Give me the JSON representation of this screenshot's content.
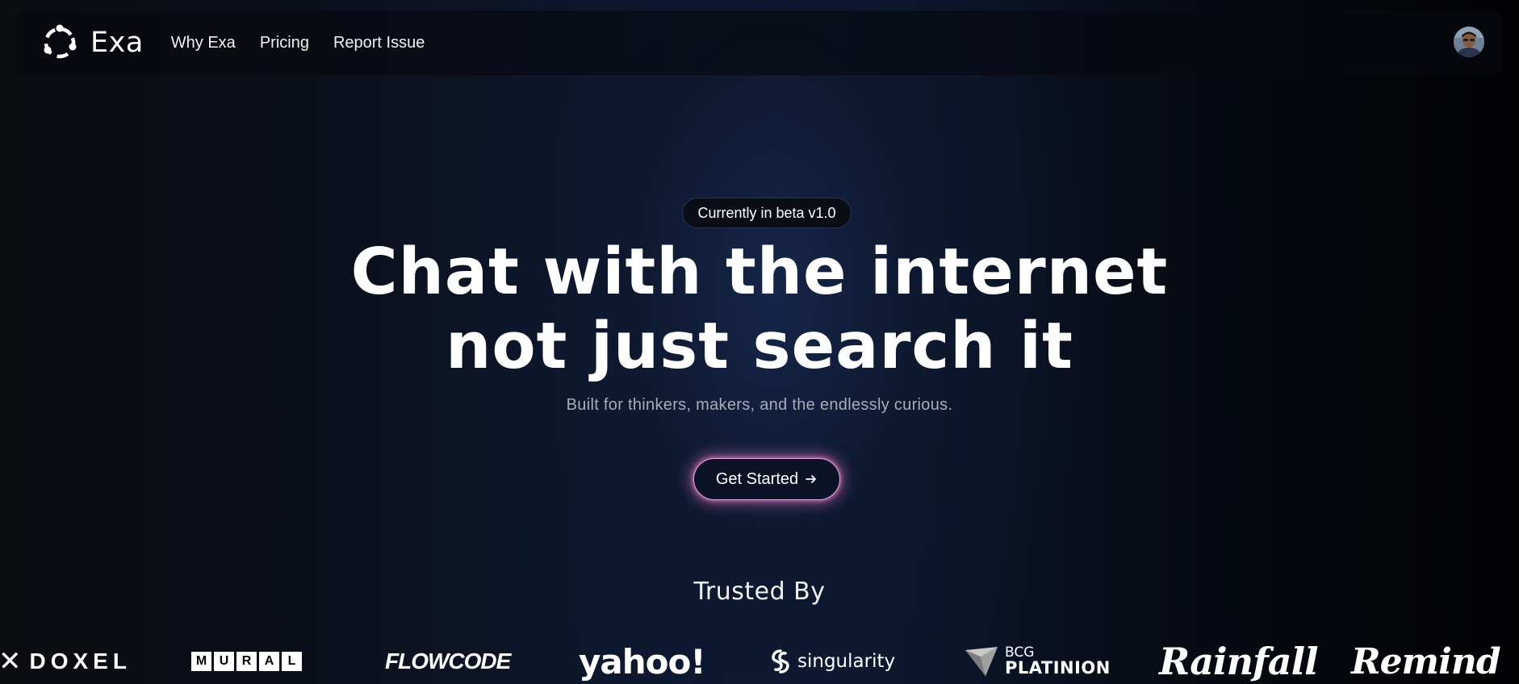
{
  "nav": {
    "brand": "Exa",
    "links": [
      "Why Exa",
      "Pricing",
      "Report Issue"
    ]
  },
  "hero": {
    "badge": "Currently in beta v1.0",
    "title_line1": "Chat with the internet",
    "title_line2": "not just search it",
    "subtitle": "Built for thinkers, makers, and the endlessly curious.",
    "cta_label": "Get Started"
  },
  "trusted": {
    "heading": "Trusted By",
    "logos": {
      "doxel": "DOXEL",
      "mural": [
        "M",
        "U",
        "R",
        "A",
        "L"
      ],
      "flowcode": "FLOWCODE",
      "yahoo": "yahoo!",
      "singularity": "singularity",
      "bcg_top": "BCG",
      "bcg_bottom": "PLATINION",
      "rainfall": "Rainfall",
      "remind": "Remind"
    }
  },
  "colors": {
    "cta_glow": "#e770c4",
    "background_center": "#0d1a33",
    "subtitle": "#a9adb8"
  },
  "icons": {
    "brand": "exa-logo-icon",
    "cta": "arrow-right-icon",
    "avatar": "user-avatar"
  }
}
